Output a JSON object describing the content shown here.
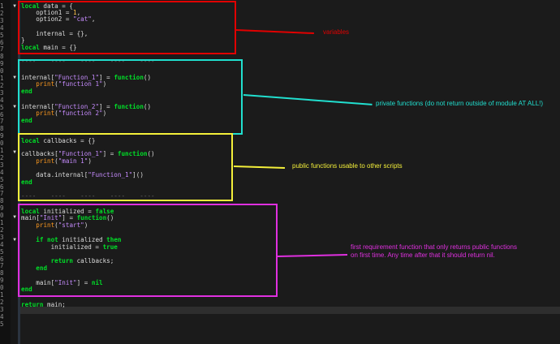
{
  "colors": {
    "background": "#1b1b1b",
    "keyword": "#00e028",
    "string": "#c78cff",
    "number": "#ffc24a",
    "function_call": "#ff9a1f",
    "box_red": "#e10000",
    "box_cyan": "#21dfcf",
    "box_yellow": "#f4f03a",
    "box_magenta": "#e030e0"
  },
  "icons": {
    "fold_marker": "caret-down-icon"
  },
  "line_numbers": [
    "1",
    "2",
    "3",
    "4",
    "5",
    "6",
    "7",
    "8",
    "9",
    "0",
    "1",
    "2",
    "3",
    "4",
    "5",
    "6",
    "7",
    "8",
    "9",
    "0",
    "1",
    "2",
    "3",
    "4",
    "5",
    "6",
    "7",
    "8",
    "9",
    "0",
    "1",
    "2",
    "3",
    "4",
    "5",
    "6",
    "7",
    "8",
    "9",
    "0",
    "1",
    "2",
    "3",
    "4",
    "5"
  ],
  "code": {
    "l1": [
      "local",
      " data = {"
    ],
    "l2": [
      "    option1 = ",
      "1",
      ","
    ],
    "l3": [
      "    option2 = ",
      "\"cat\"",
      ","
    ],
    "l5": [
      "    internal = {},"
    ],
    "l6": [
      "}"
    ],
    "l7": [
      "local",
      " main = {}"
    ],
    "l9": [
      "----    ----    ----    ----    ----"
    ],
    "l12": [
      "internal[",
      "\"Function_1\"",
      "] = ",
      "function",
      "()"
    ],
    "l13": [
      "    ",
      "print",
      "(",
      "\"function 1\"",
      ")"
    ],
    "l14": [
      "end"
    ],
    "l16": [
      "internal[",
      "\"Function_2\"",
      "] = ",
      "function",
      "()"
    ],
    "l17": [
      "    ",
      "print",
      "(",
      "\"function 2\"",
      ")"
    ],
    "l18": [
      "end"
    ],
    "l21": [
      "local",
      " callbacks = {}"
    ],
    "l23": [
      "callbacks[",
      "\"Function_1\"",
      "] = ",
      "function",
      "()"
    ],
    "l24": [
      "    ",
      "print",
      "(",
      "\"main 1\"",
      ")"
    ],
    "l26": [
      "    data.internal[",
      "\"Function_1\"",
      "]()"
    ],
    "l27": [
      "end"
    ],
    "l29": [
      "----    ----    ----    ----    ----"
    ],
    "l32": [
      "local",
      " initialized = ",
      "false"
    ],
    "l33": [
      "main[",
      "\"Init\"",
      "] = ",
      "function",
      "()"
    ],
    "l34": [
      "    ",
      "print",
      "(",
      "\"start\"",
      ")"
    ],
    "l36": [
      "    ",
      "if not",
      " initialized ",
      "then"
    ],
    "l37": [
      "        initialized = ",
      "true"
    ],
    "l39": [
      "        ",
      "return",
      " callbacks;"
    ],
    "l40": [
      "    ",
      "end"
    ],
    "l42": [
      "    main[",
      "\"Init\"",
      "] = ",
      "nil"
    ],
    "l43": [
      "end"
    ],
    "l45": [
      "return",
      " main;"
    ]
  },
  "annotations": {
    "variables": "variables",
    "private": "private functions (do not return outside of module AT ALL!)",
    "public": "public functions usable to other scripts",
    "init_line1": "first requirement function that only returns public functions",
    "init_line2": "on first time. Any time after that it should return nil."
  }
}
